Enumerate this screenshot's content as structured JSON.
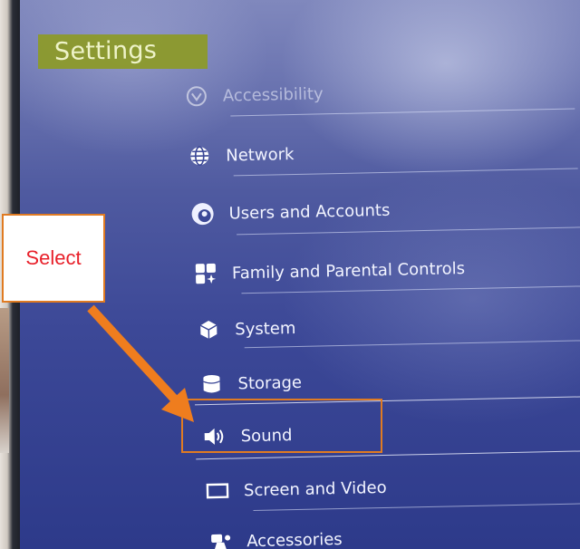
{
  "title": "Settings",
  "callout": {
    "label": "Select"
  },
  "menu": {
    "items": [
      {
        "label": "Accessibility",
        "icon": "accessibility-icon"
      },
      {
        "label": "Network",
        "icon": "globe-icon"
      },
      {
        "label": "Users and Accounts",
        "icon": "user-avatar-icon"
      },
      {
        "label": "Family and Parental Controls",
        "icon": "family-icon"
      },
      {
        "label": "System",
        "icon": "cube-icon"
      },
      {
        "label": "Storage",
        "icon": "database-icon"
      },
      {
        "label": "Sound",
        "icon": "speaker-icon"
      },
      {
        "label": "Screen and Video",
        "icon": "screen-icon"
      },
      {
        "label": "Accessories",
        "icon": "controller-icon"
      }
    ],
    "selected": "Sound"
  },
  "colors": {
    "callout_border": "#e07b22",
    "callout_text": "#e8202a",
    "title_bg": "#8c9a2a"
  }
}
